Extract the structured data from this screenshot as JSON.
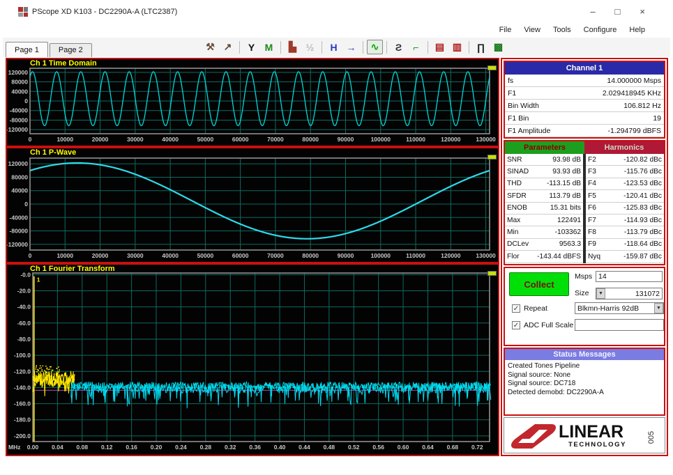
{
  "window": {
    "title": "PScope XD K103 - DC2290A-A (LTC2387)",
    "menus": [
      "File",
      "View",
      "Tools",
      "Configure",
      "Help"
    ],
    "controls": {
      "minimize": "–",
      "maximize": "□",
      "close": "×"
    },
    "tabs": [
      "Page 1",
      "Page 2"
    ],
    "active_tab": "Page 1"
  },
  "toolbar": {
    "icons": [
      {
        "name": "measure-tools-icon",
        "glyph": "⚒",
        "color": "#6b4f3f"
      },
      {
        "name": "cursor-arrow-icon",
        "glyph": "↗",
        "color": "#5a4632"
      },
      {
        "sep": true
      },
      {
        "name": "filter-y-icon",
        "glyph": "Y",
        "color": "#101010"
      },
      {
        "name": "window-function-icon",
        "glyph": "M",
        "color": "#1c8a1c"
      },
      {
        "sep": true
      },
      {
        "name": "histogram-icon",
        "glyph": "▙",
        "color": "#a03a2a"
      },
      {
        "name": "phase-plot-icon",
        "glyph": "½",
        "color": "#b8b8b8"
      },
      {
        "sep": true
      },
      {
        "name": "average-hold-icon",
        "glyph": "H",
        "color": "#2238c8"
      },
      {
        "name": "average-run-icon",
        "glyph": "→",
        "color": "#2238c8"
      },
      {
        "sep": true
      },
      {
        "name": "wave-mode-icon",
        "glyph": "∿",
        "color": "#18a018",
        "pressed": true
      },
      {
        "sep": true
      },
      {
        "name": "loop-icon",
        "glyph": "Ƨ",
        "color": "#333333"
      },
      {
        "name": "trace-icon",
        "glyph": "⌐",
        "color": "#18a018"
      },
      {
        "sep": true
      },
      {
        "name": "device-a-icon",
        "glyph": "▤",
        "color": "#b02020"
      },
      {
        "name": "device-b-icon",
        "glyph": "▥",
        "color": "#b02020"
      },
      {
        "sep": true
      },
      {
        "name": "pulse-icon",
        "glyph": "∏",
        "color": "#202020"
      },
      {
        "name": "screenshot-icon",
        "glyph": "▩",
        "color": "#1a7a1a"
      }
    ]
  },
  "channel1": {
    "header": "Channel 1",
    "rows": [
      [
        "fs",
        "14.000000 Msps"
      ],
      [
        "F1",
        "2.029418945 KHz"
      ],
      [
        "Bin Width",
        "106.812 Hz"
      ],
      [
        "F1 Bin",
        "19"
      ],
      [
        "F1 Amplitude",
        "-1.294799 dBFS"
      ]
    ]
  },
  "parameters": {
    "header": "Parameters",
    "rows": [
      [
        "SNR",
        "93.98 dB"
      ],
      [
        "SINAD",
        "93.93 dB"
      ],
      [
        "THD",
        "-113.15 dB"
      ],
      [
        "SFDR",
        "113.79 dB"
      ],
      [
        "ENOB",
        "15.31 bits"
      ],
      [
        "Max",
        "122491"
      ],
      [
        "Min",
        "-103362"
      ],
      [
        "DCLev",
        "9563.3"
      ],
      [
        "Flor",
        "-143.44 dBFS"
      ]
    ]
  },
  "harmonics": {
    "header": "Harmonics",
    "rows": [
      [
        "F2",
        "-120.82 dBc"
      ],
      [
        "F3",
        "-115.76 dBc"
      ],
      [
        "F4",
        "-123.53 dBc"
      ],
      [
        "F5",
        "-120.41 dBc"
      ],
      [
        "F6",
        "-125.83 dBc"
      ],
      [
        "F7",
        "-114.93 dBc"
      ],
      [
        "F8",
        "-113.79 dBc"
      ],
      [
        "F9",
        "-118.64 dBc"
      ],
      [
        "Nyq",
        "-159.87 dBc"
      ]
    ]
  },
  "collect": {
    "button": "Collect",
    "msps_label": "Msps",
    "msps_value": "14",
    "size_label": "Size",
    "size_value": "131072",
    "repeat_label": "Repeat",
    "repeat_checked": true,
    "window_value": "Blkmn-Harris 92dB",
    "adc_label": "ADC Full Scale",
    "adc_checked": true,
    "adc_value": ""
  },
  "status": {
    "header": "Status Messages",
    "lines": [
      "Created Tones Pipeline",
      "Signal source: None",
      "Signal source: DC718",
      "Detected demobd: DC2290A-A"
    ]
  },
  "logo": {
    "brand": "LINEAR",
    "sub": "TECHNOLOGY",
    "mark_color": "#c1272d"
  },
  "figure_number": "005",
  "chart_data": [
    {
      "id": "time_domain",
      "type": "line",
      "title": "Ch 1 Time Domain",
      "bg": "#030303",
      "grid_color": "#0d6b61",
      "border_color": "#9a9a9a",
      "legend_chip_color": "#c8e000",
      "xlim": [
        0,
        131072
      ],
      "ylim": [
        -137000,
        137000
      ],
      "x_ticks": {
        "values": [
          0,
          10000,
          20000,
          30000,
          40000,
          50000,
          60000,
          70000,
          80000,
          90000,
          100000,
          110000,
          120000,
          130000
        ],
        "labels": [
          "0",
          "10000",
          "20000",
          "30000",
          "40000",
          "50000",
          "60000",
          "70000",
          "80000",
          "90000",
          "100000",
          "110000",
          "120000",
          "130000"
        ]
      },
      "y_ticks": {
        "values": [
          120000,
          80000,
          40000,
          0,
          -40000,
          -80000,
          -120000
        ],
        "labels": [
          "120000",
          "80000",
          "40000",
          "0",
          "-40000",
          "-80000",
          "-120000"
        ]
      },
      "series": [
        {
          "kind": "sine",
          "name": "ch1-time",
          "color": "#00d9d9",
          "width": 1.3,
          "amplitude": 112927,
          "offset": 9563,
          "cycles": 19,
          "phase_deg": 53
        }
      ]
    },
    {
      "id": "p_wave",
      "type": "line",
      "title": "Ch 1 P-Wave",
      "bg": "#030303",
      "grid_color": "#0d6b61",
      "border_color": "#9a9a9a",
      "legend_chip_color": "#c8e000",
      "xlim": [
        0,
        131072
      ],
      "ylim": [
        -137000,
        137000
      ],
      "x_ticks": {
        "values": [
          0,
          10000,
          20000,
          30000,
          40000,
          50000,
          60000,
          70000,
          80000,
          90000,
          100000,
          110000,
          120000,
          130000
        ],
        "labels": [
          "0",
          "10000",
          "20000",
          "30000",
          "40000",
          "50000",
          "60000",
          "70000",
          "80000",
          "90000",
          "100000",
          "110000",
          "120000",
          "130000"
        ]
      },
      "y_ticks": {
        "values": [
          120000,
          80000,
          40000,
          0,
          -40000,
          -80000,
          -120000
        ],
        "labels": [
          "120000",
          "80000",
          "40000",
          "0",
          "-40000",
          "-80000",
          "-120000"
        ]
      },
      "series": [
        {
          "kind": "sine",
          "name": "ch1-pwave",
          "color": "#2fd9e9",
          "width": 2.2,
          "amplitude": 112927,
          "offset": 9563,
          "cycles": 1,
          "phase_deg": 53
        }
      ]
    },
    {
      "id": "fourier_transform",
      "type": "line",
      "title": "Ch 1 Fourier Transform",
      "bg": "#030303",
      "grid_color": "#0d6b61",
      "border_color": "#9a9a9a",
      "legend_chip_color": "#c8e000",
      "x_prefix": "MHz",
      "xlim": [
        0,
        0.74
      ],
      "ylim": [
        -207,
        2
      ],
      "x_ticks": {
        "values": [
          0,
          0.04,
          0.08,
          0.12,
          0.16,
          0.2,
          0.24,
          0.28,
          0.32,
          0.36,
          0.4,
          0.44,
          0.48,
          0.52,
          0.56,
          0.6,
          0.64,
          0.68,
          0.72
        ],
        "labels": [
          "0.00",
          "0.04",
          "0.08",
          "0.12",
          "0.16",
          "0.20",
          "0.24",
          "0.28",
          "0.32",
          "0.36",
          "0.40",
          "0.44",
          "0.48",
          "0.52",
          "0.56",
          "0.60",
          "0.64",
          "0.68",
          "0.72"
        ]
      },
      "y_ticks": {
        "values": [
          0,
          -20,
          -40,
          -60,
          -80,
          -100,
          -120,
          -140,
          -160,
          -180,
          -200
        ],
        "labels": [
          "-0.0",
          "-20.0",
          "-40.0",
          "-60.0",
          "-80.0",
          "-100.0",
          "-120.0",
          "-140.0",
          "-160.0",
          "-180.0",
          "-200.0"
        ]
      },
      "noise_floor_dbfs": -143.44,
      "fundamental_mhz": 0.00203,
      "series": [
        {
          "kind": "hline",
          "name": "noise-floor-marker",
          "y": -143.44,
          "color": "#b04ab0",
          "width": 1
        },
        {
          "kind": "noise",
          "name": "fft-low-freq-noise-a",
          "from": 0.0005,
          "to": 0.068,
          "step": 0.0006,
          "base": -128,
          "spread": 9,
          "spike_p": 0.05,
          "spike_extra": 14,
          "color": "#ffe800",
          "width": 1
        },
        {
          "kind": "noise",
          "name": "fft-low-freq-noise-b",
          "from": 0.0005,
          "to": 0.068,
          "step": 0.0009,
          "base": -132,
          "spread": 8,
          "spike_p": 0.08,
          "spike_extra": 14,
          "color": "#ffe800",
          "width": 1
        },
        {
          "kind": "noise",
          "name": "fft-noise-a",
          "from": 0.062,
          "to": 0.742,
          "step": 0.0008,
          "base": -138,
          "spread": 5,
          "spike_p": 0.1,
          "spike_extra": 26,
          "color": "#00dcf0",
          "width": 1
        },
        {
          "kind": "noise",
          "name": "fft-noise-b",
          "from": 0.062,
          "to": 0.742,
          "step": 0.0012,
          "base": -141,
          "spread": 6,
          "spike_p": 0.14,
          "spike_extra": 22,
          "color": "#00dcf0",
          "width": 1
        },
        {
          "kind": "dots",
          "name": "fft-low-scatter",
          "from": 0.004,
          "to": 0.045,
          "base": -119,
          "spread": 7,
          "count": 45,
          "color": "#ffe800"
        },
        {
          "kind": "spike",
          "name": "fundamental-tone",
          "x": 0.00203,
          "top": -2,
          "color": "#ffe800",
          "width": 1.6,
          "label": "1"
        }
      ]
    }
  ]
}
